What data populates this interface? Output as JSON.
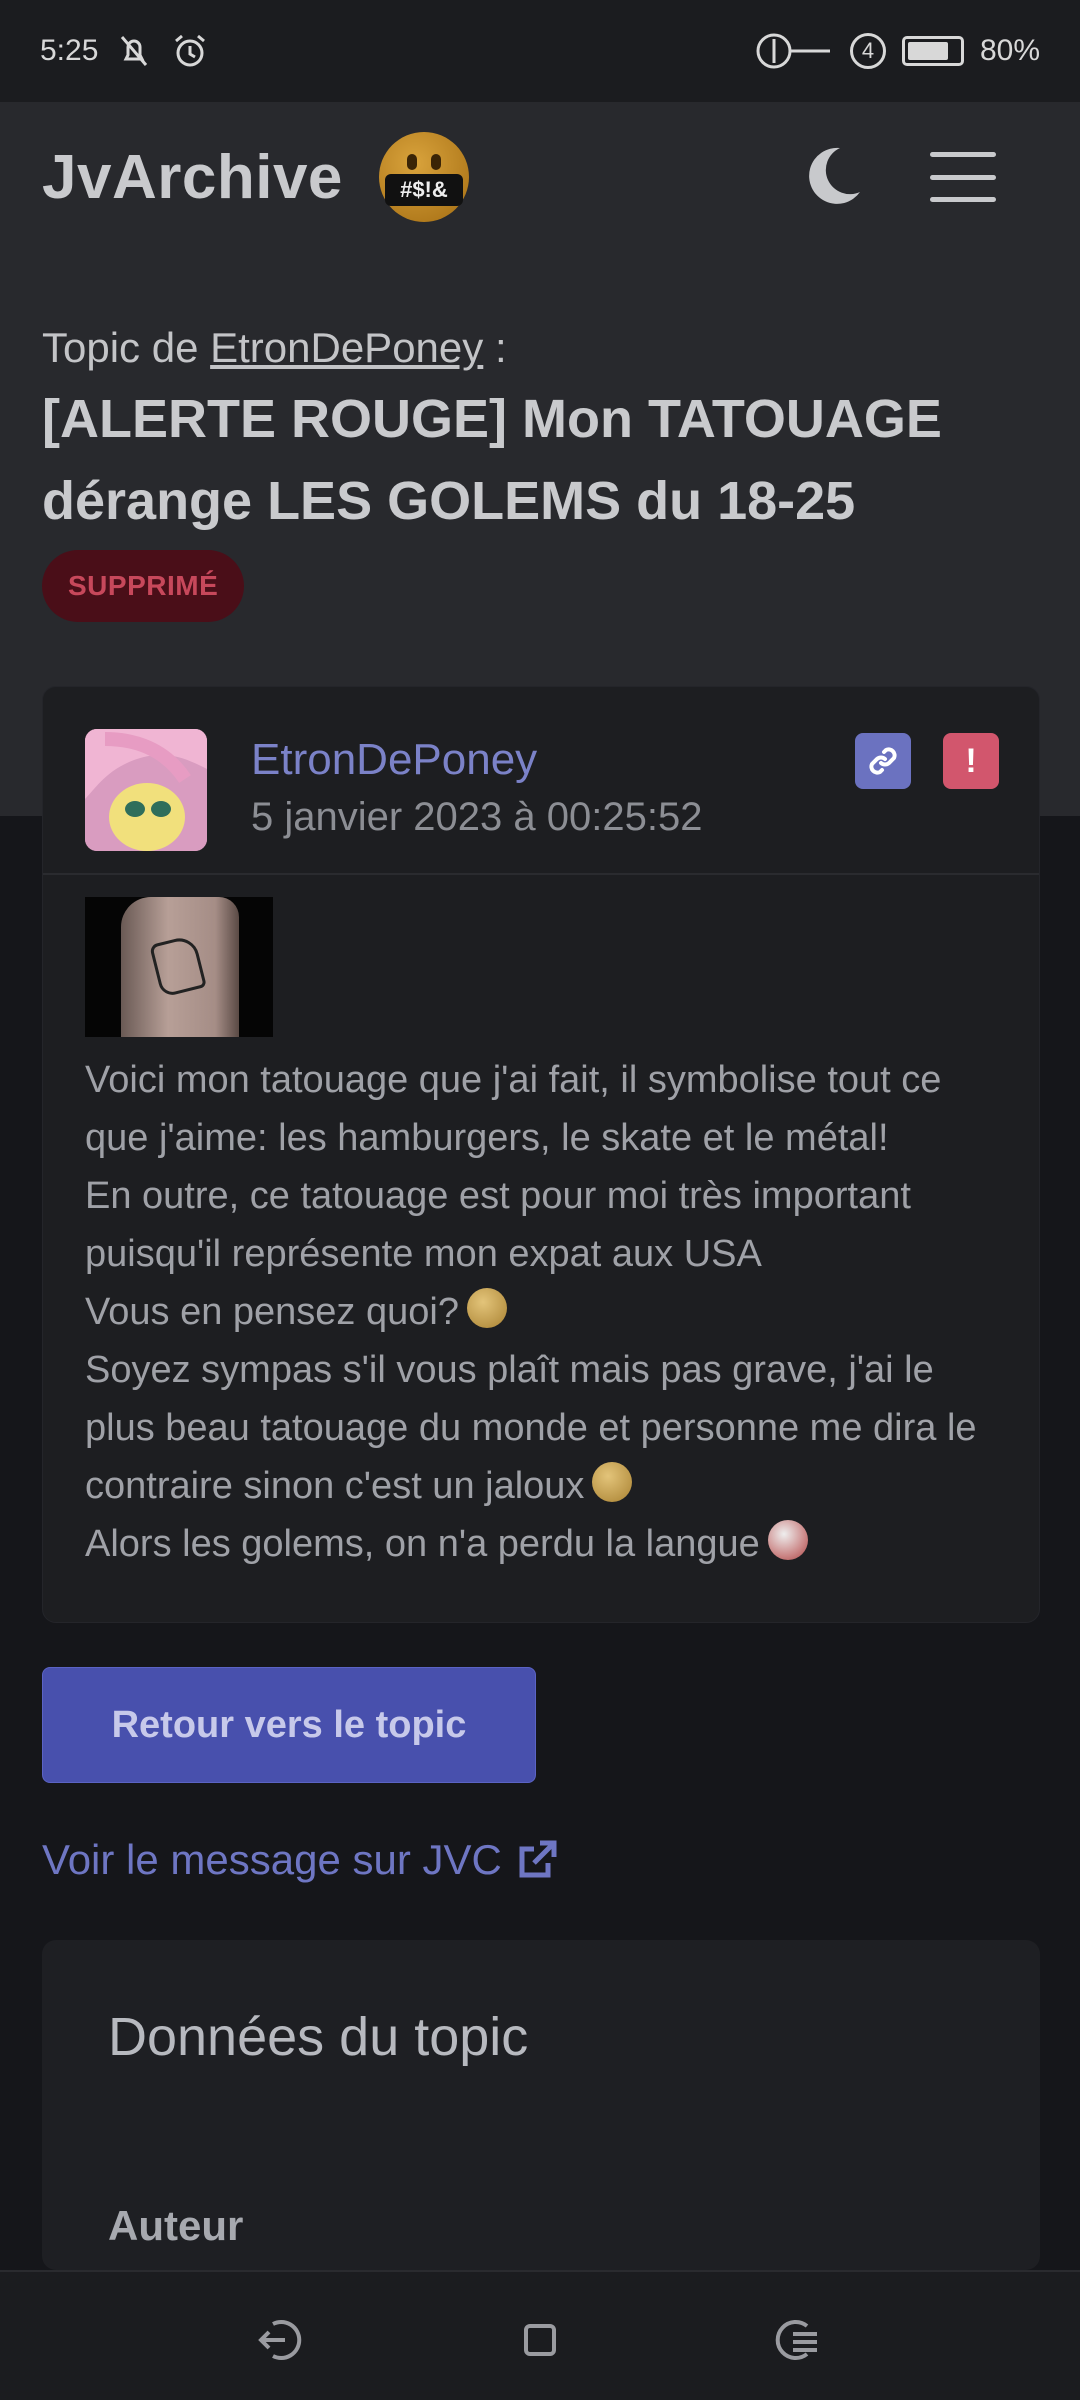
{
  "status_bar": {
    "time": "5:25",
    "battery": "80%",
    "battery_level": 0.8,
    "sim_badge": "4"
  },
  "navbar": {
    "brand": "JvArchive",
    "logo_text": "#$!&",
    "icons": [
      "moon-icon",
      "menu-icon"
    ]
  },
  "topic": {
    "by_prefix": "Topic de ",
    "author": "EtronDePoney",
    "by_suffix": " :",
    "title": "[ALERTE ROUGE] Mon TATOUAGE dérange LES GOLEMS du 18-25",
    "status": "SUPPRIMÉ"
  },
  "message": {
    "author": "EtronDePoney",
    "date": "5 janvier 2023 à 00:25:52",
    "lines": [
      "Voici mon tatouage que j'ai fait, il symbolise tout ce que j'aime: les hamburgers, le skate et le métal!",
      "En outre, ce tatouage est pour moi très important puisqu'il représente mon expat aux USA",
      "Vous en pensez quoi?",
      "Soyez sympas s'il vous plaît mais pas grave, j'ai le plus beau tatouage du monde et personne me dira le contraire sinon c'est un jaloux",
      "Alors les golems, on n'a perdu la langue"
    ],
    "report_symbol": "!",
    "link_symbol": "🔗"
  },
  "actions": {
    "back_button": "Retour vers le topic",
    "jvc_link": "Voir le message sur JVC"
  },
  "topic_data": {
    "title": "Données du topic",
    "author_label": "Auteur"
  },
  "colors": {
    "accent": "#4850ad",
    "link": "#7b82c8",
    "danger": "#d2566d",
    "deleted_badge_bg": "#4a0e18"
  }
}
